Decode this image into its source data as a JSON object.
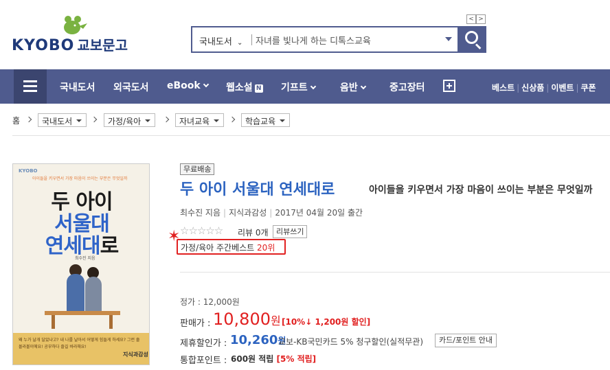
{
  "header": {
    "logo_en": "KYOBO",
    "logo_ko": "교보문고",
    "pager_prev": "<",
    "pager_next": ">",
    "search": {
      "category": "국내도서",
      "value": "자녀를 빛나게 하는 디톡스교육"
    }
  },
  "nav": {
    "items": [
      "국내도서",
      "외국도서",
      "eBook",
      "웹소설",
      "기프트",
      "음반",
      "중고장터"
    ],
    "badge": "N",
    "right_links": [
      "베스트",
      "신상품",
      "이벤트",
      "쿠폰"
    ]
  },
  "breadcrumb": {
    "home": "홈",
    "levels": [
      "국내도서",
      "가정/육아",
      "자녀교육",
      "학습교육"
    ]
  },
  "cover": {
    "top_brand": "KYOBO",
    "tagline": "아이들을 키우면서 가장 마음이 쓰이는 부분은 무엇일까",
    "line1": "두 아이",
    "line2": "서울대",
    "line3a": "연세대",
    "line3b": "로",
    "author": "최수진 지음",
    "bottom_text": "왜 누가 날개 달았냐고? 내 나를 날아서 어떻게 힘들게 하세요? 그런 줄 몰라볼이에요! 공부하다 즐길 바라해요!",
    "publisher": "지식과감성"
  },
  "product": {
    "badge_free": "무료배송",
    "title": "두 아이 서울대 연세대로",
    "subtitle": "아이들을 키우면서 가장 마음이 쓰이는 부분은 무엇일까",
    "author": "최수진 지음",
    "publisher": "지식과감성",
    "pub_date": "2017년 04월 20일 출간",
    "stars": "☆☆☆☆☆",
    "review_count": "리뷰 0개",
    "review_btn": "리뷰쓰기",
    "best_label": "가정/육아 주간베스트",
    "best_rank": "20위",
    "list_price": "정가 : 12,000원",
    "sale_label": "판매가 :",
    "sale_price": "10,800",
    "won": "원",
    "discount": "[10%↓ 1,200원 할인]",
    "card_label": "제휴할인가 :",
    "card_price": "10,260",
    "card_desc": "교보-KB국민카드 5% 청구할인(실적무관)",
    "card_btn": "카드/포인트 안내",
    "point_label": "통합포인트 :",
    "point_value": "600원 적립",
    "point_pct": "[5% 적립]"
  }
}
